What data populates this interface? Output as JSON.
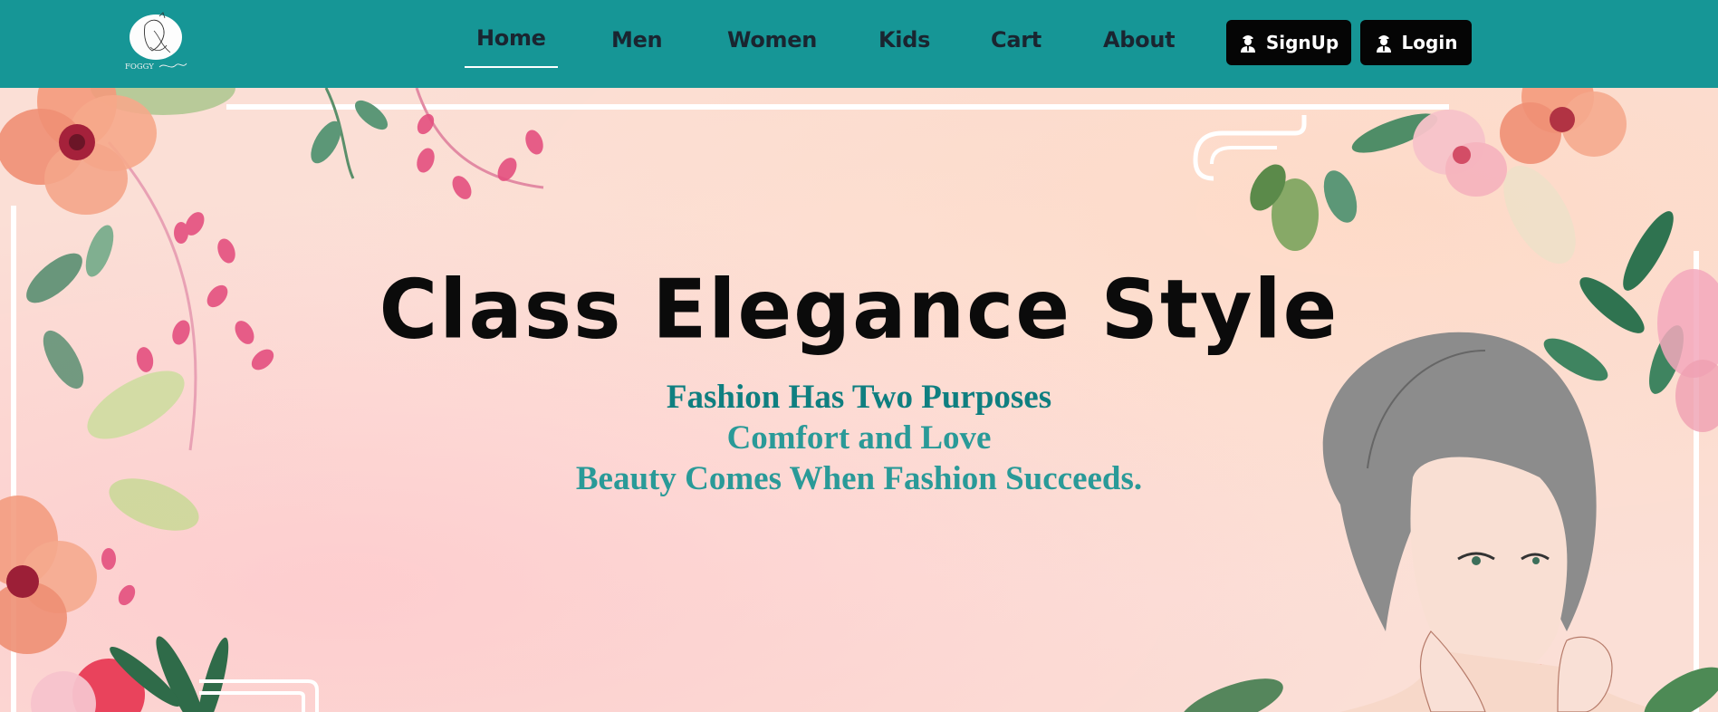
{
  "brand": {
    "logo_text": "FOGGY"
  },
  "nav": {
    "items": [
      {
        "label": "Home",
        "active": true
      },
      {
        "label": "Men"
      },
      {
        "label": "Women"
      },
      {
        "label": "Kids"
      },
      {
        "label": "Cart"
      },
      {
        "label": "About"
      }
    ],
    "signup_label": "SignUp",
    "login_label": "Login"
  },
  "hero": {
    "headline": "Class Elegance Style",
    "taglines": [
      "Fashion Has Two Purposes",
      "Comfort and Love",
      "Beauty Comes When Fashion Succeeds."
    ]
  },
  "colors": {
    "navbar": "#169696",
    "button": "#050505",
    "tagline_dark": "#0f7f80",
    "tagline_light": "#2a9a98"
  }
}
